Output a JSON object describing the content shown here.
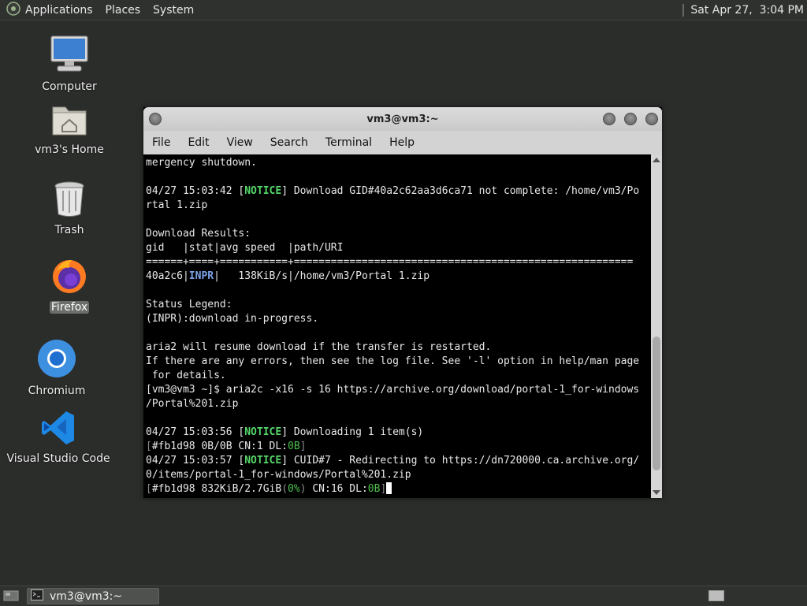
{
  "top_panel": {
    "menus": [
      "Applications",
      "Places",
      "System"
    ],
    "clock": "Sat Apr 27,  3:04 PM"
  },
  "desktop_icons": [
    {
      "label": "Computer",
      "icon": "computer-icon"
    },
    {
      "label": "vm3's Home",
      "icon": "home-folder-icon"
    },
    {
      "label": "Trash",
      "icon": "trash-icon"
    },
    {
      "label": "Firefox",
      "icon": "firefox-icon",
      "selected": true
    },
    {
      "label": "Chromium",
      "icon": "chromium-icon"
    },
    {
      "label": "Visual Studio Code",
      "icon": "vscode-icon"
    }
  ],
  "terminal": {
    "title": "vm3@vm3:~",
    "menu": [
      "File",
      "Edit",
      "View",
      "Search",
      "Terminal",
      "Help"
    ],
    "lines": [
      "mergency shutdown.",
      "",
      "04/27 15:03:42 [NOTICE] Download GID#40a2c62aa3d6ca71 not complete: /home/vm3/Po",
      "rtal 1.zip",
      "",
      "Download Results:",
      "gid   |stat|avg speed  |path/URI",
      "======+====+===========+=======================================================",
      "40a2c6|INPR|   138KiB/s|/home/vm3/Portal 1.zip",
      "",
      "Status Legend:",
      "(INPR):download in-progress.",
      "",
      "aria2 will resume download if the transfer is restarted.",
      "If there are any errors, then see the log file. See '-l' option in help/man page",
      " for details.",
      "[vm3@vm3 ~]$ aria2c -x16 -s 16 https://archive.org/download/portal-1_for-windows",
      "/Portal%201.zip",
      "",
      "04/27 15:03:56 [NOTICE] Downloading 1 item(s)",
      "[#fb1d98 0B/0B CN:1 DL:0B]",
      "04/27 15:03:57 [NOTICE] CUID#7 - Redirecting to https://dn720000.ca.archive.org/",
      "0/items/portal-1_for-windows/Portal%201.zip",
      "[#fb1d98 832KiB/2.7GiB(0%) CN:16 DL:0B]"
    ],
    "scroll_position": 0.92,
    "scroll_visible_fraction": 0.42
  },
  "bottom_panel": {
    "task_label": "vm3@vm3:~"
  },
  "colors": {
    "desktop_bg": "#2b2d2b",
    "notice": "#55d66a",
    "inpr": "#7aa2e8",
    "dl_green": "#4ec04e"
  }
}
